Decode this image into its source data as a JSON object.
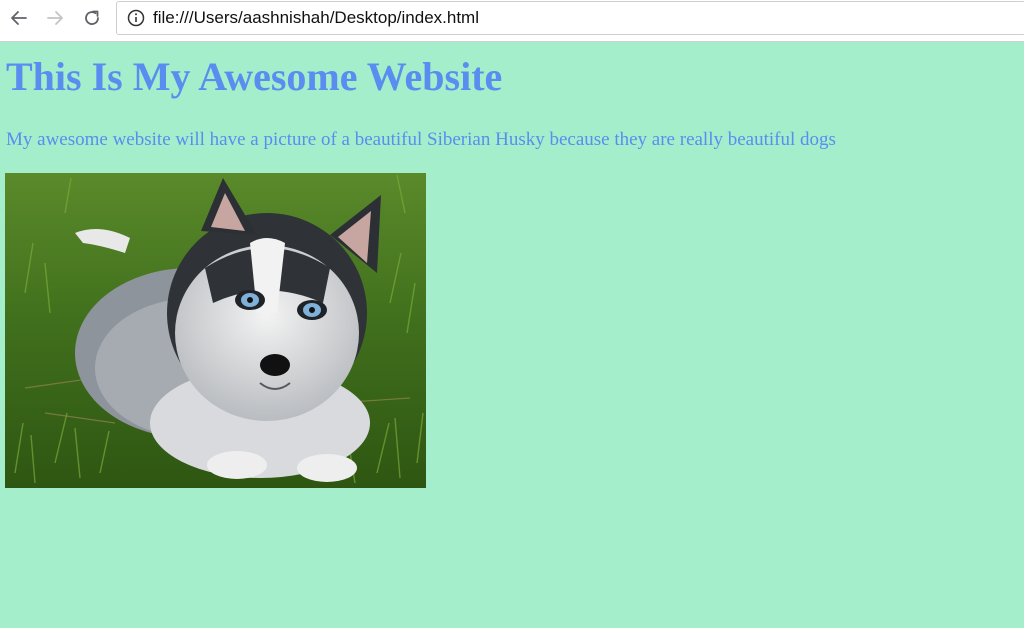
{
  "browser": {
    "address_bar": {
      "url": "file:///Users/aashnishah/Desktop/index.html"
    },
    "icons": {
      "back": "back-arrow-icon",
      "forward": "forward-arrow-icon",
      "reload": "reload-icon",
      "info": "info-icon"
    }
  },
  "page": {
    "background_color": "#a4eecb",
    "text_color": "#5b8cf0",
    "heading": "This Is My Awesome Website",
    "description": "My awesome website will have a picture of a beautiful Siberian Husky because they are really beautiful dogs",
    "image_subject": "siberian-husky-puppy-on-grass"
  }
}
